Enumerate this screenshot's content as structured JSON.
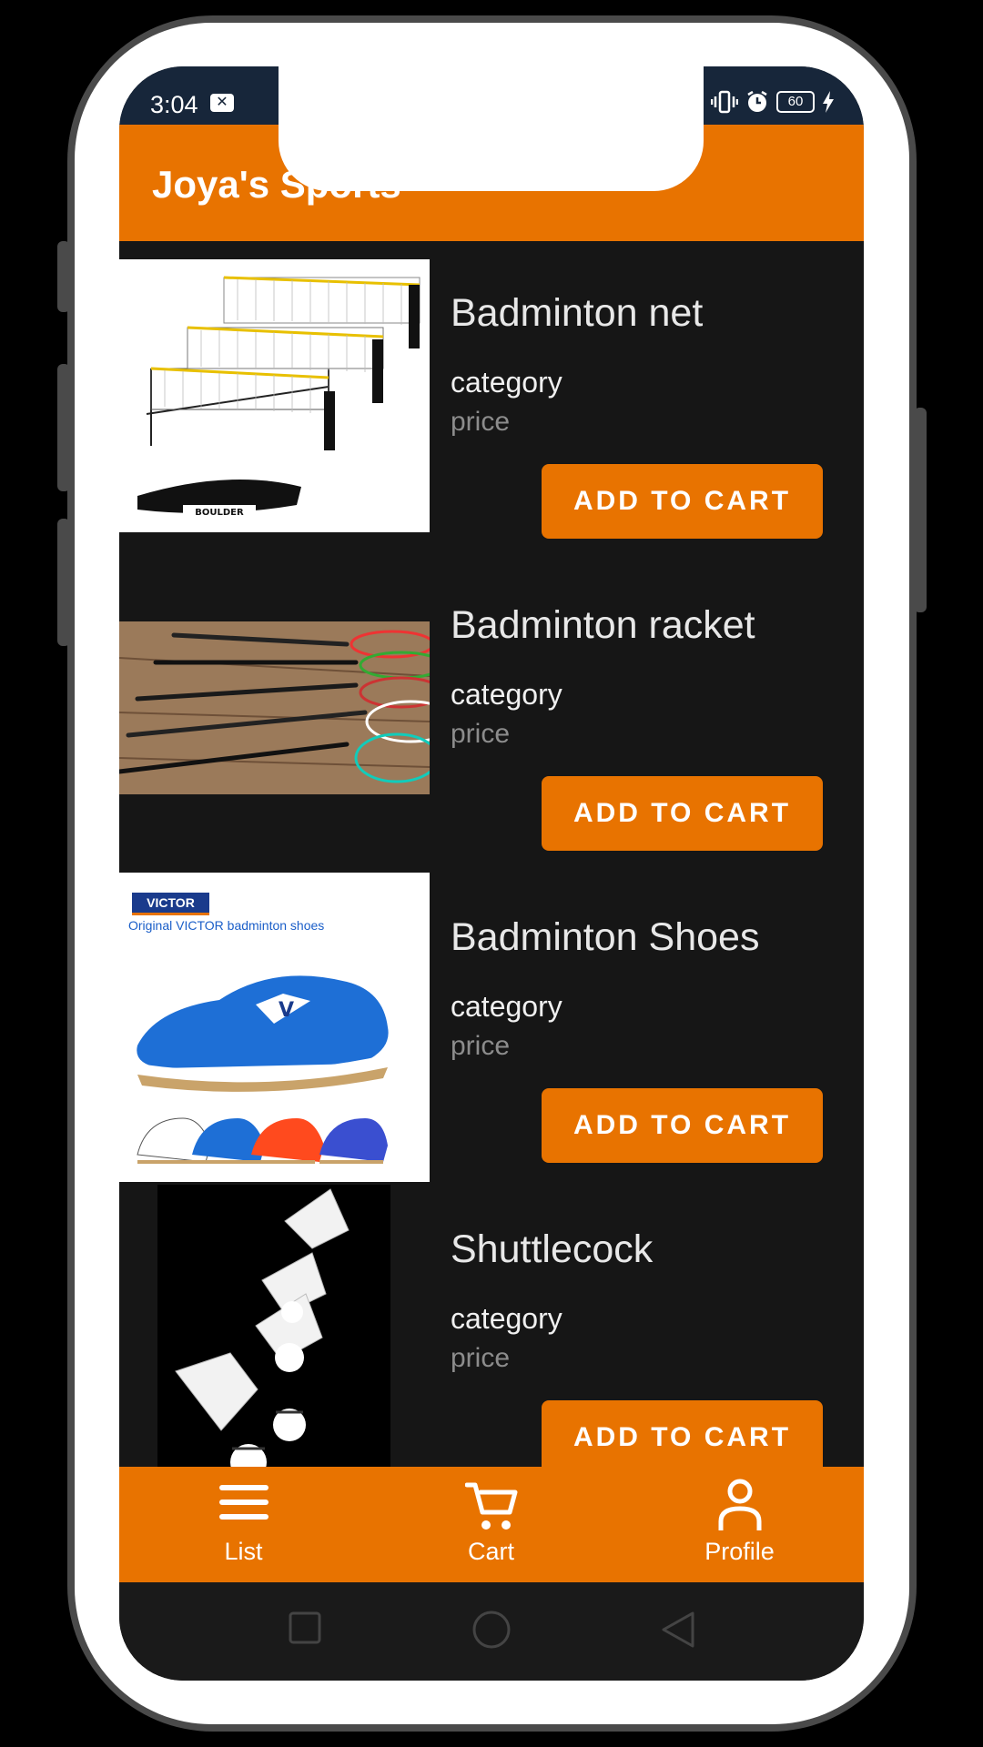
{
  "status_bar": {
    "time": "3:04",
    "battery": "60"
  },
  "app_bar": {
    "title": "Joya's Sports"
  },
  "products": [
    {
      "name": "Badminton net",
      "category": "category",
      "price": "price",
      "button": "ADD TO CART"
    },
    {
      "name": "Badminton racket",
      "category": "category",
      "price": "price",
      "button": "ADD TO CART"
    },
    {
      "name": "Badminton Shoes",
      "category": "category",
      "price": "price",
      "button": "ADD TO CART",
      "image_text": {
        "brand": "VICTOR",
        "caption": "Original VICTOR badminton shoes"
      }
    },
    {
      "name": "Shuttlecock",
      "category": "category",
      "price": "price",
      "button": "ADD TO CART"
    }
  ],
  "bottom_nav": [
    {
      "label": "List",
      "icon": "menu-icon"
    },
    {
      "label": "Cart",
      "icon": "cart-icon"
    },
    {
      "label": "Profile",
      "icon": "profile-icon"
    }
  ],
  "colors": {
    "accent": "#e87300",
    "background": "#161616",
    "status_bar": "#17263a"
  }
}
